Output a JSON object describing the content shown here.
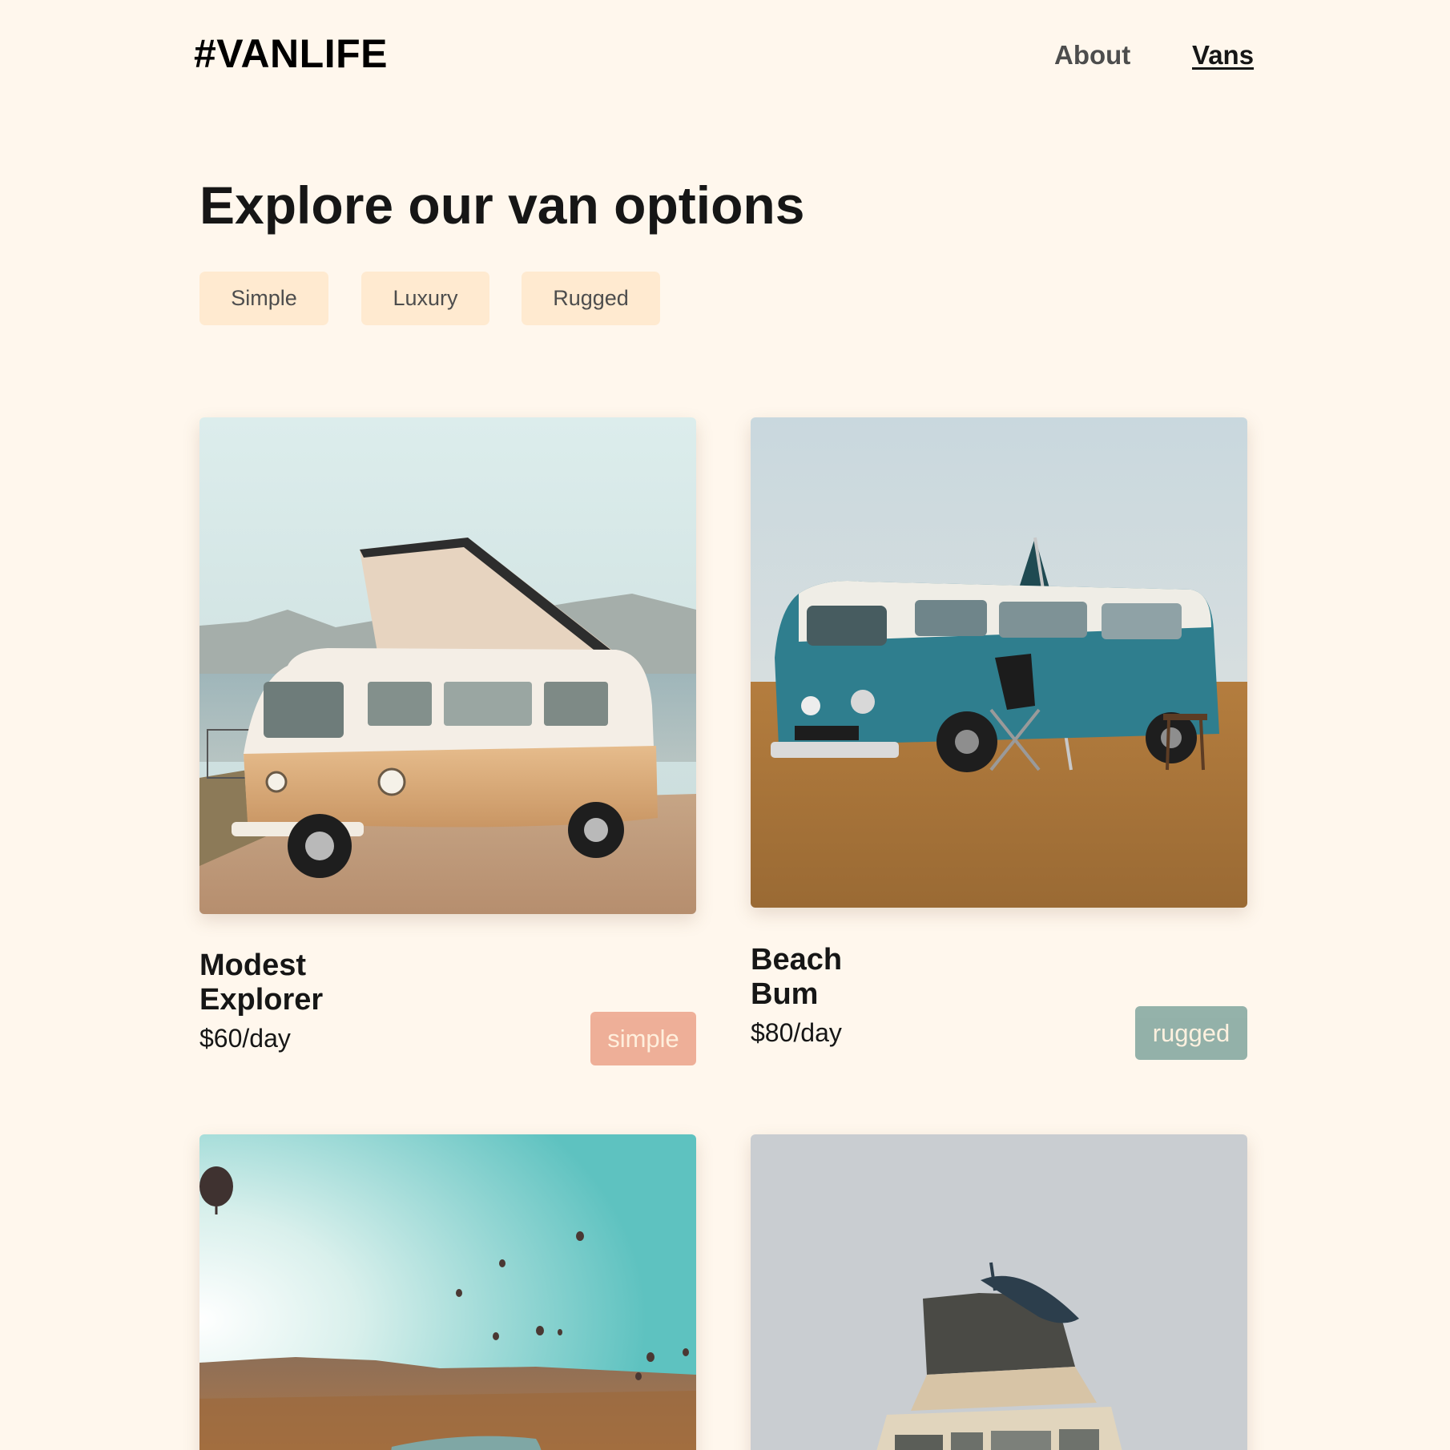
{
  "header": {
    "logo": "#VANLIFE",
    "nav": [
      {
        "label": "About"
      },
      {
        "label": "Vans"
      }
    ]
  },
  "main": {
    "title": "Explore our van options",
    "filters": [
      {
        "label": "Simple"
      },
      {
        "label": "Luxury"
      },
      {
        "label": "Rugged"
      }
    ],
    "vans": [
      {
        "name": "Modest Explorer",
        "price": "$60/day",
        "type": "simple"
      },
      {
        "name": "Beach Bum",
        "price": "$80/day",
        "type": "rugged"
      },
      {
        "name": "",
        "price": "",
        "type": ""
      },
      {
        "name": "",
        "price": "",
        "type": ""
      }
    ]
  },
  "colors": {
    "background": "#FFF7ED",
    "filter_bg": "#FFEAD0",
    "simple_badge": "#E17654",
    "rugged_badge": "#115E59"
  }
}
